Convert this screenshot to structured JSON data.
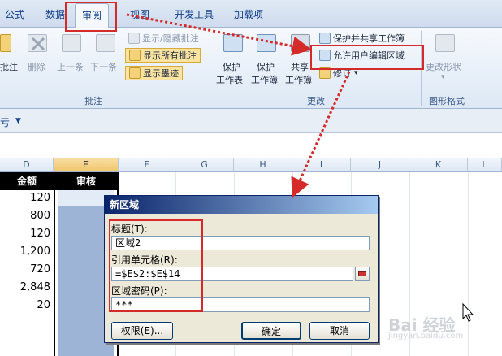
{
  "tabs": [
    "公式",
    "数据",
    "审阅",
    "视图",
    "开发工具",
    "加载项"
  ],
  "ribbon": {
    "comment_group": {
      "label": "批注",
      "buttons": [
        "批注",
        "删除",
        "上一条",
        "下一条"
      ],
      "toggles": [
        "显示/隐藏批注",
        "显示所有批注",
        "显示墨迹"
      ]
    },
    "changes_group": {
      "label": "更改",
      "protect_sheet": [
        "保护",
        "工作表"
      ],
      "protect_workbook": [
        "保护",
        "工作簿"
      ],
      "share_workbook": [
        "共享",
        "工作簿"
      ],
      "protect_share": "保护并共享工作簿",
      "allow_edit_ranges": "允许用户编辑区域",
      "track_changes": "修订"
    },
    "shape_group": {
      "label": "图形格式",
      "change_shape": "更改形状"
    }
  },
  "quickbar": {
    "glyph": "亏",
    "arrow": "▼"
  },
  "columns": [
    "D",
    "E",
    "F",
    "G",
    "H",
    "I",
    "J",
    "K",
    "L"
  ],
  "headers": {
    "amount": "金额",
    "review": "审核"
  },
  "amounts": [
    "120",
    "800",
    "120",
    "1,200",
    "720",
    "2,848",
    "20"
  ],
  "dialog": {
    "title": "新区域",
    "title_label": "标题(T):",
    "title_value": "区域2",
    "ref_label": "引用单元格(R):",
    "ref_value": "=$E$2:$E$14",
    "pwd_label": "区域密码(P):",
    "pwd_value": "***",
    "perm_button": "权限(E)...",
    "ok_button": "确定",
    "cancel_button": "取消"
  },
  "watermark": "Bai 经验",
  "watermark_sub": "jingyan.baidu.com"
}
